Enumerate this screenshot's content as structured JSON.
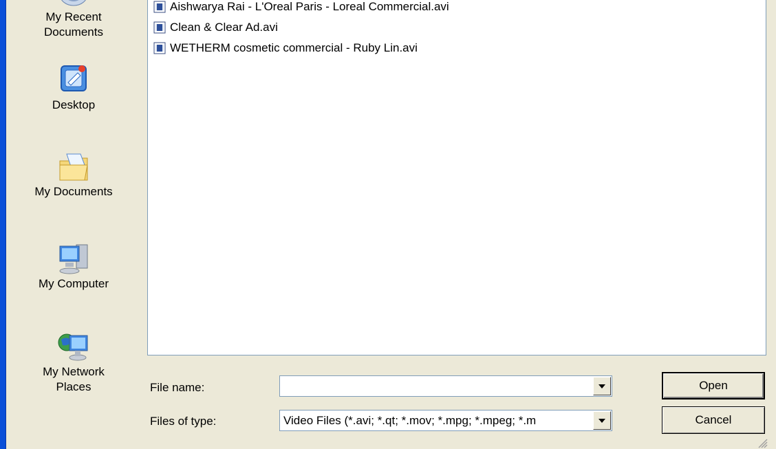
{
  "places": [
    {
      "label": "My Recent\nDocuments",
      "icon": "recent-documents-icon"
    },
    {
      "label": "Desktop",
      "icon": "desktop-icon"
    },
    {
      "label": "My Documents",
      "icon": "my-documents-folder-icon"
    },
    {
      "label": "My Computer",
      "icon": "my-computer-icon"
    },
    {
      "label": "My Network\nPlaces",
      "icon": "network-places-icon"
    }
  ],
  "files": [
    "Aishwarya Rai - L'Oreal Paris - Loreal Commercial.avi",
    "Clean & Clear Ad.avi",
    "WETHERM cosmetic commercial - Ruby Lin.avi"
  ],
  "file_icon": "video-file-icon",
  "file_name": {
    "label": "File name:",
    "value": ""
  },
  "file_type": {
    "label": "Files of type:",
    "value": "Video Files (*.avi; *.qt; *.mov; *.mpg; *.mpeg; *.m"
  },
  "buttons": {
    "open": "Open",
    "cancel": "Cancel"
  },
  "colors": {
    "window_border": "#0a4fd8",
    "dialog_bg": "#ece9d8",
    "list_border": "#7f9db9"
  }
}
